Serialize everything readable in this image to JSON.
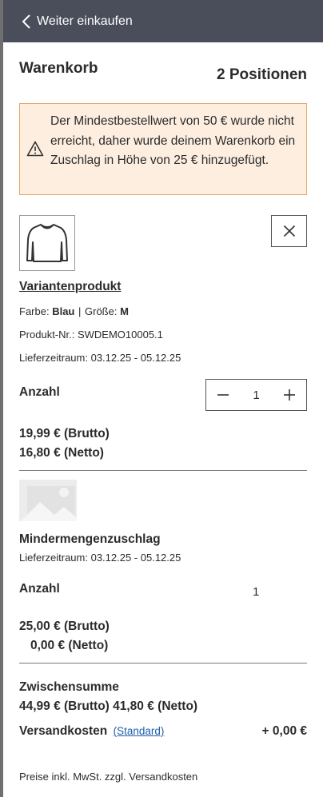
{
  "header": {
    "back_label": "Weiter einkaufen"
  },
  "cart": {
    "title": "Warenkorb",
    "count": "2 Positionen"
  },
  "alert": {
    "text": "Der Mindestbestellwert von 50 € wurde nicht erreicht, daher wurde deinem Warenkorb ein Zuschlag in Höhe von 25 € hinzugefügt."
  },
  "items": [
    {
      "name": "Variantenprodukt",
      "color_label": "Farbe:",
      "color_value": "Blau",
      "size_label": "Größe:",
      "size_value": "M",
      "product_number": "Produkt-Nr.: SWDEMO10005.1",
      "delivery": "Lieferzeitraum: 03.12.25 - 05.12.25",
      "qty_label": "Anzahl",
      "qty": "1",
      "gross": "19,99 € (Brutto)",
      "net": "16,80 € (Netto)"
    },
    {
      "name": "Mindermengenzuschlag",
      "delivery": "Lieferzeitraum: 03.12.25 - 05.12.25",
      "qty_label": "Anzahl",
      "qty": "1",
      "gross": "25,00 € (Brutto)",
      "net": "0,00 € (Netto)"
    }
  ],
  "summary": {
    "subtotal_label": "Zwischensumme",
    "subtotal_value": "44,99 € (Brutto) 41,80 € (Netto)",
    "shipping_label": "Versandkosten",
    "shipping_method": "(Standard)",
    "shipping_value": "+ 0,00 €",
    "tax_note": "Preise inkl. MwSt. zzgl. Versandkosten"
  },
  "colors": {
    "header_bg": "#4a4e5a",
    "alert_bg": "#fdeee0",
    "alert_border": "#e9a767",
    "link": "#1f5fa8"
  },
  "icons": [
    "chevron-left-icon",
    "warning-icon",
    "shirt-icon",
    "close-icon",
    "minus-icon",
    "plus-icon",
    "image-placeholder-icon"
  ]
}
